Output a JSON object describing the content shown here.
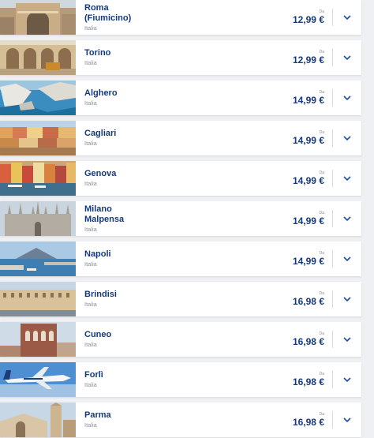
{
  "labels": {
    "from": "Da",
    "expand_icon": "chevron-down-icon"
  },
  "colors": {
    "city_text": "#163a78",
    "price_text": "#163a78",
    "muted_text": "#8a8f98",
    "background": "#eef0f3",
    "card": "#ffffff"
  },
  "destinations": [
    {
      "city": "Roma\n(Fiumicino)",
      "country": "Italia",
      "price": "12,99 €",
      "image": "roma-thumbnail"
    },
    {
      "city": "Torino",
      "country": "Italia",
      "price": "12,99 €",
      "image": "torino-thumbnail"
    },
    {
      "city": "Alghero",
      "country": "Italia",
      "price": "14,99 €",
      "image": "alghero-thumbnail"
    },
    {
      "city": "Cagliari",
      "country": "Italia",
      "price": "14,99 €",
      "image": "cagliari-thumbnail"
    },
    {
      "city": "Genova",
      "country": "Italia",
      "price": "14,99 €",
      "image": "genova-thumbnail"
    },
    {
      "city": "Milano\nMalpensa",
      "country": "Italia",
      "price": "14,99 €",
      "image": "milano-thumbnail"
    },
    {
      "city": "Napoli",
      "country": "Italia",
      "price": "14,99 €",
      "image": "napoli-thumbnail"
    },
    {
      "city": "Brindisi",
      "country": "Italia",
      "price": "16,98 €",
      "image": "brindisi-thumbnail"
    },
    {
      "city": "Cuneo",
      "country": "Italia",
      "price": "16,98 €",
      "image": "cuneo-thumbnail"
    },
    {
      "city": "Forlì",
      "country": "Italia",
      "price": "16,98 €",
      "image": "forli-thumbnail"
    },
    {
      "city": "Parma",
      "country": "Italia",
      "price": "16,98 €",
      "image": "parma-thumbnail"
    }
  ]
}
